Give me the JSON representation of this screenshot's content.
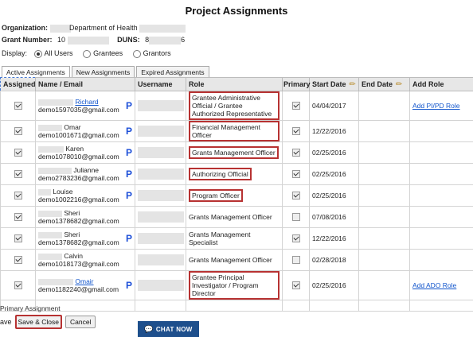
{
  "page": {
    "title": "Project Assignments"
  },
  "meta": {
    "organization_label": "Organization:",
    "organization_value": "Department of Health",
    "grant_label": "Grant Number:",
    "grant_value_prefix": "10",
    "duns_label": "DUNS:",
    "duns_prefix": "8",
    "duns_suffix": "6"
  },
  "display": {
    "label": "Display:",
    "options": [
      {
        "label": "All Users",
        "selected": true
      },
      {
        "label": "Grantees",
        "selected": false
      },
      {
        "label": "Grantors",
        "selected": false
      }
    ]
  },
  "tabs": [
    {
      "label": "Active Assignments",
      "active": true
    },
    {
      "label": "New Assignments",
      "active": false
    },
    {
      "label": "Expired Assignments",
      "active": false
    }
  ],
  "table": {
    "headers": {
      "assigned": "Assigned",
      "name_email": "Name / Email",
      "username": "Username",
      "role": "Role",
      "primary": "Primary",
      "start_date": "Start Date",
      "end_date": "End Date",
      "add_role": "Add Role"
    },
    "rows": [
      {
        "first": "Richard",
        "email": "demo1597035@gmail.com",
        "link": true,
        "p": "P",
        "role": "Grantee Administrative Official / Grantee Authorized Representative",
        "role_highlight": true,
        "primary": true,
        "start": "04/04/2017",
        "end": "",
        "add_role": "Add PI/PD Role",
        "tall": true
      },
      {
        "first": "Omar",
        "email": "demo1001671@gmail.com",
        "link": false,
        "p": "P",
        "role": "Financial Management Officer",
        "role_highlight": true,
        "primary": true,
        "start": "12/22/2016",
        "end": "",
        "add_role": ""
      },
      {
        "first": "Karen",
        "email": "demo1078010@gmail.com",
        "link": false,
        "p": "P",
        "role": "Grants Management Officer",
        "role_highlight": true,
        "primary": true,
        "start": "02/25/2016",
        "end": "",
        "add_role": ""
      },
      {
        "first": "Julianne",
        "email": "demo2783236@gmail.com",
        "link": false,
        "p": "P",
        "role": "Authorizing Official",
        "role_highlight": true,
        "primary": true,
        "start": "02/25/2016",
        "end": "",
        "add_role": "",
        "dashed_addrole": true
      },
      {
        "first": "Louise",
        "email": "demo1002216@gmail.com",
        "link": false,
        "p": "P",
        "role": "Program Officer",
        "role_highlight": true,
        "primary": true,
        "start": "02/25/2016",
        "end": "",
        "add_role": ""
      },
      {
        "first": "Sheri",
        "email": "demo1378682@gmail.com",
        "link": false,
        "p": "",
        "role": "Grants Management Officer",
        "role_highlight": false,
        "primary": false,
        "start": "07/08/2016",
        "end": "",
        "add_role": ""
      },
      {
        "first": "Sheri",
        "email": "demo1378682@gmail.com",
        "link": false,
        "p": "P",
        "role": "Grants Management Specialist",
        "role_highlight": false,
        "primary": true,
        "start": "12/22/2016",
        "end": "",
        "add_role": ""
      },
      {
        "first": "Calvin",
        "email": "demo1018173@gmail.com",
        "link": false,
        "p": "",
        "role": "Grants Management Officer",
        "role_highlight": false,
        "primary": false,
        "start": "02/28/2018",
        "end": "",
        "add_role": ""
      },
      {
        "first": "Omair",
        "email": "demo1182240@gmail.com",
        "link": true,
        "p": "P",
        "role": "Grantee Principal Investigator / Program Director",
        "role_highlight": true,
        "primary": true,
        "start": "02/25/2016",
        "end": "",
        "add_role": "Add ADO Role",
        "tall": true
      }
    ]
  },
  "footer": {
    "note": "Primary Assignment",
    "save_fragment": "ave",
    "save_close_label": "Save & Close",
    "cancel_label": "Cancel",
    "chat_label": "CHAT NOW",
    "chat_icon": "chat-bubble-icon"
  },
  "colors": {
    "highlight": "#b73232",
    "link": "#1155cc",
    "p_mark": "#1d4fd8",
    "chat_bg": "#1e4f8c"
  }
}
